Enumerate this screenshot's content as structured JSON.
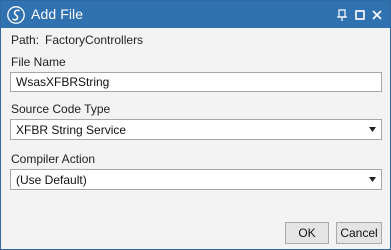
{
  "window": {
    "title": "Add File",
    "icon": "script-logo-icon",
    "controls": [
      "pin-icon",
      "maximize-icon",
      "close-icon"
    ]
  },
  "path": {
    "label": "Path:",
    "value": "FactoryControllers"
  },
  "file_name": {
    "label": "File Name",
    "value": "WsasXFBRString"
  },
  "source_code_type": {
    "label": "Source Code Type",
    "selected": "XFBR String Service"
  },
  "compiler_action": {
    "label": "Compiler Action",
    "selected": "(Use Default)"
  },
  "buttons": {
    "ok": "OK",
    "cancel": "Cancel"
  },
  "colors": {
    "titlebar": "#3071b0",
    "background": "#f3f3f3",
    "button": "#e4e4e4"
  }
}
